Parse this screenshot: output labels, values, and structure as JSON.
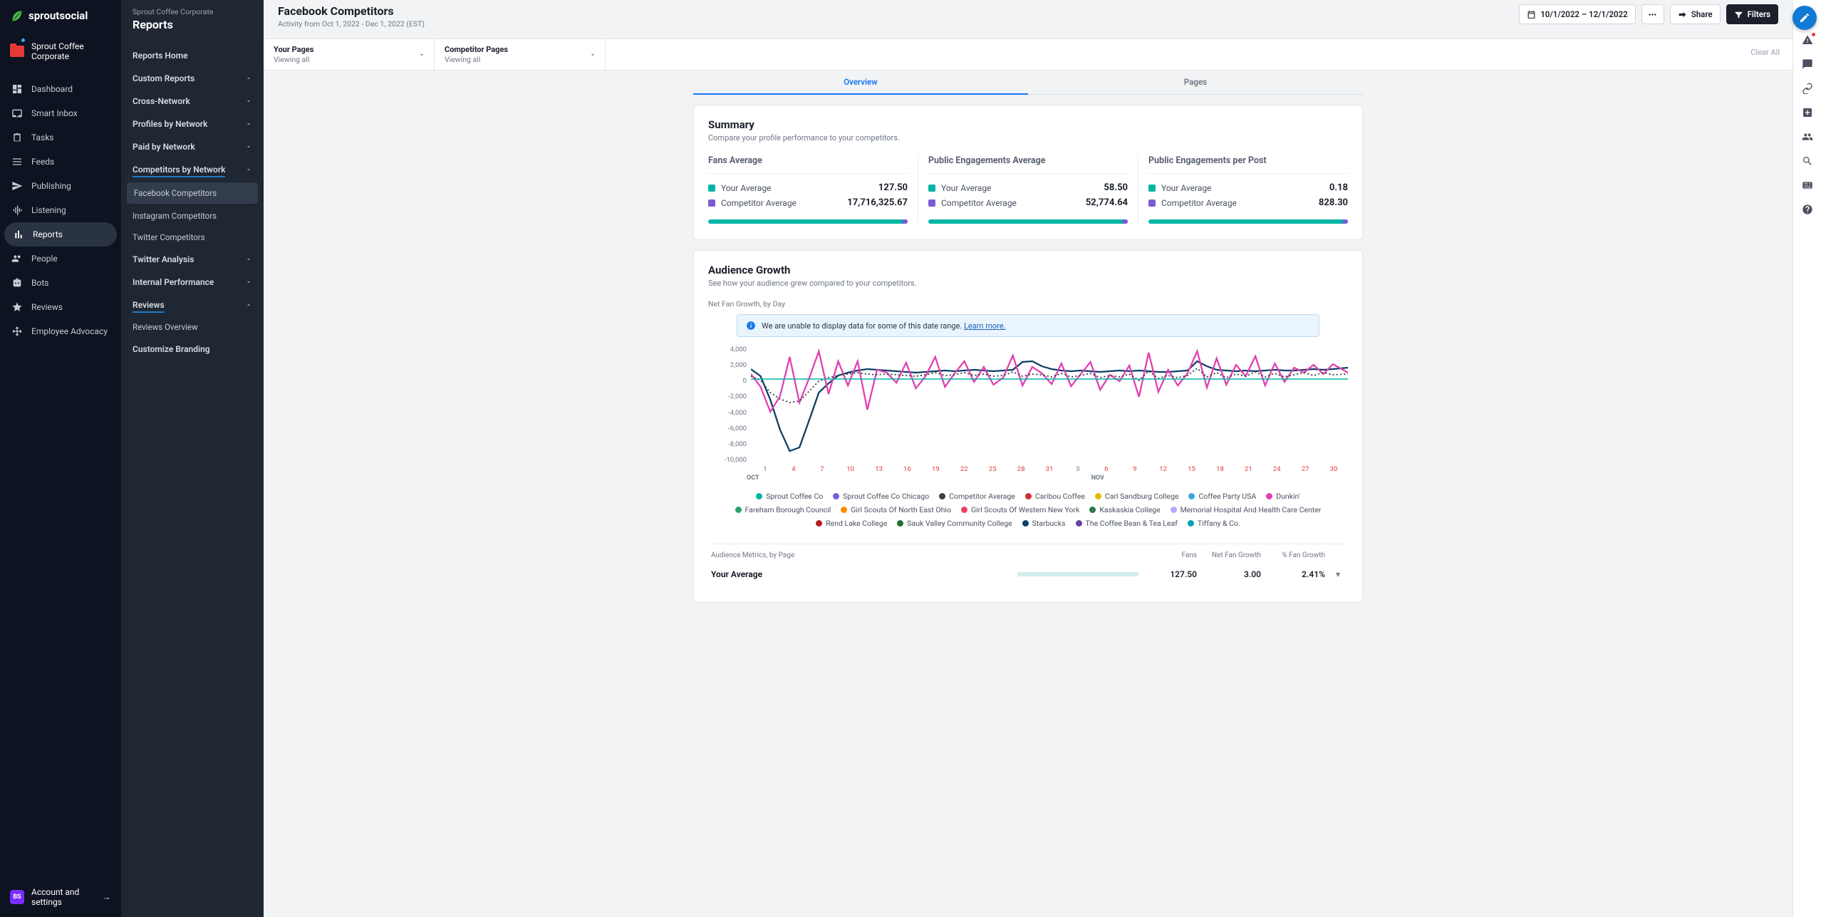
{
  "brand": "sproutsocial",
  "workspace": "Sprout Coffee Corporate",
  "nav": [
    {
      "id": "dashboard",
      "label": "Dashboard"
    },
    {
      "id": "smart-inbox",
      "label": "Smart Inbox"
    },
    {
      "id": "tasks",
      "label": "Tasks"
    },
    {
      "id": "feeds",
      "label": "Feeds"
    },
    {
      "id": "publishing",
      "label": "Publishing"
    },
    {
      "id": "listening",
      "label": "Listening"
    },
    {
      "id": "reports",
      "label": "Reports",
      "active": true
    },
    {
      "id": "people",
      "label": "People"
    },
    {
      "id": "bots",
      "label": "Bots"
    },
    {
      "id": "reviews",
      "label": "Reviews"
    },
    {
      "id": "advocacy",
      "label": "Employee Advocacy"
    }
  ],
  "footer": {
    "initials": "BS",
    "label": "Account and settings"
  },
  "side": {
    "crumb": "Sprout Coffee Corporate",
    "title": "Reports",
    "items": [
      {
        "type": "link",
        "label": "Reports Home"
      },
      {
        "type": "group",
        "label": "Custom Reports"
      },
      {
        "type": "group",
        "label": "Cross-Network"
      },
      {
        "type": "group",
        "label": "Profiles by Network"
      },
      {
        "type": "group",
        "label": "Paid by Network"
      },
      {
        "type": "group",
        "label": "Competitors by Network",
        "open": true,
        "children": [
          {
            "label": "Facebook Competitors",
            "active": true
          },
          {
            "label": "Instagram Competitors"
          },
          {
            "label": "Twitter Competitors"
          }
        ]
      },
      {
        "type": "group",
        "label": "Twitter Analysis"
      },
      {
        "type": "group",
        "label": "Internal Performance"
      },
      {
        "type": "group",
        "label": "Reviews",
        "open": true,
        "children": [
          {
            "label": "Reviews Overview"
          }
        ]
      },
      {
        "type": "link",
        "label": "Customize Branding"
      }
    ]
  },
  "top": {
    "title": "Facebook Competitors",
    "sub": "Activity from Oct 1, 2022 - Dec 1, 2022 (EST)",
    "range": "10/1/2022 – 12/1/2022",
    "share": "Share",
    "filters": "Filters"
  },
  "selectors": [
    {
      "label": "Your Pages",
      "value": "Viewing all"
    },
    {
      "label": "Competitor Pages",
      "value": "Viewing all"
    }
  ],
  "clear": "Clear All",
  "tabs": [
    {
      "label": "Overview",
      "active": true
    },
    {
      "label": "Pages"
    }
  ],
  "summary": {
    "title": "Summary",
    "desc": "Compare your profile performance to your competitors.",
    "metrics": [
      {
        "title": "Fans Average",
        "your": "127.50",
        "comp": "17,716,325.67"
      },
      {
        "title": "Public Engagements Average",
        "your": "58.50",
        "comp": "52,774.64"
      },
      {
        "title": "Public Engagements per Post",
        "your": "0.18",
        "comp": "828.30"
      }
    ],
    "yourLabel": "Your Average",
    "compLabel": "Competitor Average"
  },
  "growth": {
    "title": "Audience Growth",
    "desc": "See how your audience grew compared to your competitors.",
    "chartSub": "Net Fan Growth, by Day",
    "notice": "We are unable to display data for some of this date range. ",
    "noticeLink": "Learn more.",
    "yticks": [
      "4,000",
      "2,000",
      "0",
      "-2,000",
      "-4,000",
      "-6,000",
      "-8,000",
      "-10,000"
    ],
    "xticks": [
      {
        "l": "1"
      },
      {
        "l": "4",
        "h": true
      },
      {
        "l": "7",
        "h": true
      },
      {
        "l": "10",
        "h": true
      },
      {
        "l": "13",
        "h": true
      },
      {
        "l": "19",
        "h": true
      },
      {
        "l": "22",
        "h": true
      },
      {
        "l": "25",
        "h": true
      },
      {
        "l": "28",
        "h": true
      },
      {
        "l": "31",
        "h": true
      },
      {
        "l": "3"
      },
      {
        "l": "6",
        "h": true
      },
      {
        "l": "9",
        "h": true
      },
      {
        "l": "12",
        "h": true
      },
      {
        "l": "15",
        "h": true
      },
      {
        "l": "18",
        "h": true
      },
      {
        "l": "21",
        "h": true
      },
      {
        "l": "24",
        "h": true
      },
      {
        "l": "27",
        "h": true
      },
      {
        "l": "30",
        "h": true
      }
    ],
    "xmonths": [
      "OCT",
      "NOV"
    ],
    "legend": [
      {
        "c": "#00b5a5",
        "l": "Sprout Coffee Co"
      },
      {
        "c": "#7c5bd3",
        "l": "Sprout Coffee Co Chicago"
      },
      {
        "c": "#3b3f46",
        "l": "Competitor Average"
      },
      {
        "c": "#d12f2f",
        "l": "Caribou Coffee"
      },
      {
        "c": "#e6b800",
        "l": "Carl Sandburg College"
      },
      {
        "c": "#3aa7e0",
        "l": "Coffee Party USA"
      },
      {
        "c": "#e23fb1",
        "l": "Dunkin'"
      },
      {
        "c": "#2aa36a",
        "l": "Fareham Borough Council"
      },
      {
        "c": "#ff8a00",
        "l": "Girl Scouts Of North East Ohio"
      },
      {
        "c": "#e8425f",
        "l": "Girl Scouts Of Western New York"
      },
      {
        "c": "#2c7a4b",
        "l": "Kaskaskia College"
      },
      {
        "c": "#b9a6ff",
        "l": "Memorial Hospital And Health Care Center"
      },
      {
        "c": "#b51d1d",
        "l": "Rend Lake College"
      },
      {
        "c": "#1f6e2f",
        "l": "Sauk Valley Community College"
      },
      {
        "c": "#0d3e66",
        "l": "Starbucks"
      },
      {
        "c": "#6b3fa0",
        "l": "The Coffee Bean & Tea Leaf"
      },
      {
        "c": "#00a3b4",
        "l": "Tiffany & Co."
      }
    ]
  },
  "amTable": {
    "title": "Audience Metrics, by Page",
    "cols": [
      "Fans",
      "Net Fan Growth",
      "% Fan Growth"
    ],
    "row": {
      "label": "Your Average",
      "fans": "127.50",
      "net": "3.00",
      "pct": "2.41%"
    }
  },
  "chart_data": {
    "type": "line",
    "title": "Net Fan Growth, by Day",
    "ylabel": "Net Fan Growth",
    "ylim": [
      -10000,
      4000
    ],
    "x_start": "2022-10-01",
    "x_end": "2022-12-01",
    "note": "Values estimated from chart; minor series flat near 0 omitted.",
    "series": [
      {
        "name": "Dunkin'",
        "color": "#e23fb1",
        "approx_values_by_day_index": [
          600,
          -1000,
          -4200,
          -2200,
          2800,
          -3100,
          100,
          3500,
          -1900,
          2300,
          -900,
          2400,
          -3800,
          1200,
          900,
          -500,
          2100,
          -1200,
          400,
          2800,
          -1000,
          800,
          2300,
          -400,
          1500,
          -700,
          200,
          3000,
          -900,
          1600,
          800,
          -600,
          2000,
          -900,
          700,
          2100,
          -1400,
          600,
          -300,
          1800,
          -2200,
          3400,
          -1700,
          1200,
          -900,
          800,
          3600,
          -1100,
          2600,
          -700,
          1900,
          400,
          2800,
          -800,
          2000,
          -400,
          1600,
          900,
          1800,
          600,
          1900,
          800
        ]
      },
      {
        "name": "Starbucks",
        "color": "#0d3e66",
        "approx_values_by_day_index": [
          1200,
          300,
          -2800,
          -6500,
          -8800,
          -8300,
          -5200,
          -2000,
          -600,
          500,
          900,
          1200,
          1400,
          1300,
          1200,
          1100,
          1000,
          900,
          1000,
          1100,
          1200,
          1100,
          1200,
          1300,
          1200,
          1100,
          1200,
          1300,
          2300,
          2400,
          1800,
          1400,
          1200,
          1100,
          1200,
          1100,
          1000,
          1100,
          1200,
          1100,
          1200,
          1100,
          1000,
          1000,
          1100,
          1200,
          2500,
          1800,
          1300,
          1200,
          1100,
          1200,
          1100,
          1200,
          1300,
          1200,
          1200,
          1300,
          1400,
          1300,
          1400,
          1500
        ]
      },
      {
        "name": "Competitor Average",
        "color": "#3b3f46",
        "style": "dotted",
        "approx_values_by_day_index": [
          400,
          -200,
          -1800,
          -2600,
          -3100,
          -2900,
          -1600,
          -300,
          200,
          500,
          700,
          900,
          700,
          600,
          700,
          600,
          500,
          400,
          600,
          900,
          500,
          600,
          900,
          500,
          700,
          400,
          500,
          1000,
          400,
          700,
          600,
          300,
          800,
          300,
          500,
          800,
          200,
          500,
          300,
          700,
          -200,
          1100,
          100,
          500,
          200,
          500,
          1400,
          300,
          900,
          200,
          700,
          400,
          1000,
          300,
          800,
          300,
          700,
          500,
          900,
          500,
          900,
          600
        ]
      },
      {
        "name": "Sprout Coffee Co",
        "color": "#00b5a5",
        "flat_value": 0
      },
      {
        "name": "Sprout Coffee Co Chicago",
        "color": "#7c5bd3",
        "flat_value": 0
      }
    ]
  }
}
